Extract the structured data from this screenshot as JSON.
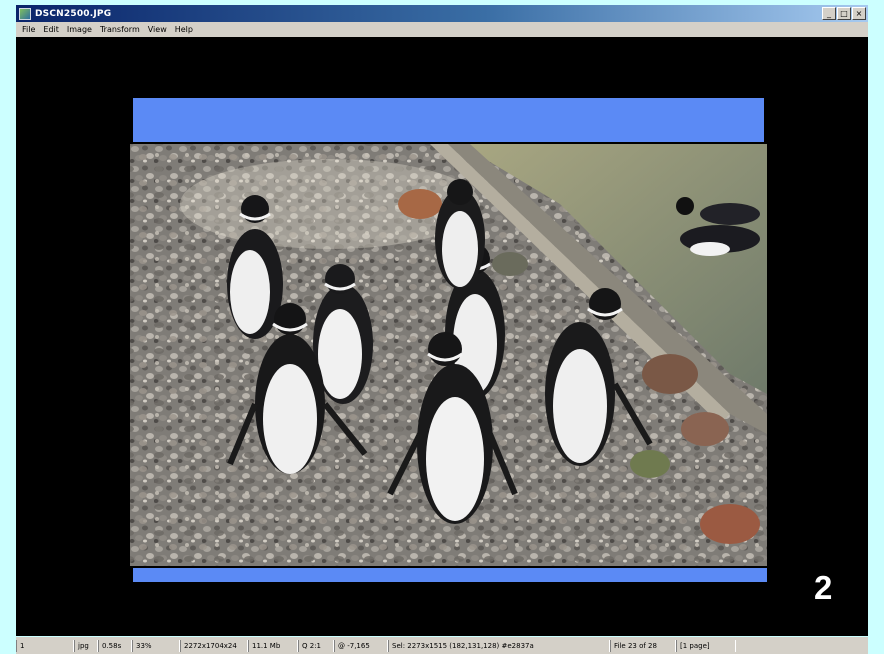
{
  "window": {
    "title": "DSCN2500.JPG",
    "controls": [
      "_",
      "□",
      "×"
    ]
  },
  "menu": [
    "File",
    "Edit",
    "Image",
    "Transform",
    "View",
    "Help"
  ],
  "slide_number": "2",
  "photo": {
    "subject": "penguins-on-rocks"
  },
  "status": [
    "1",
    "jpg",
    "0.58s",
    "33%",
    "2272x1704x24",
    "11.1 Mb",
    "Q 2:1",
    "@ -7,165",
    "Sel: 2273x1515 (182,131,128) #e2837a",
    "File 23 of 28",
    "[1 page]"
  ],
  "colors": {
    "accent_blue": "#5b8af5",
    "canvas": "#000000",
    "background": "#ccffff"
  }
}
